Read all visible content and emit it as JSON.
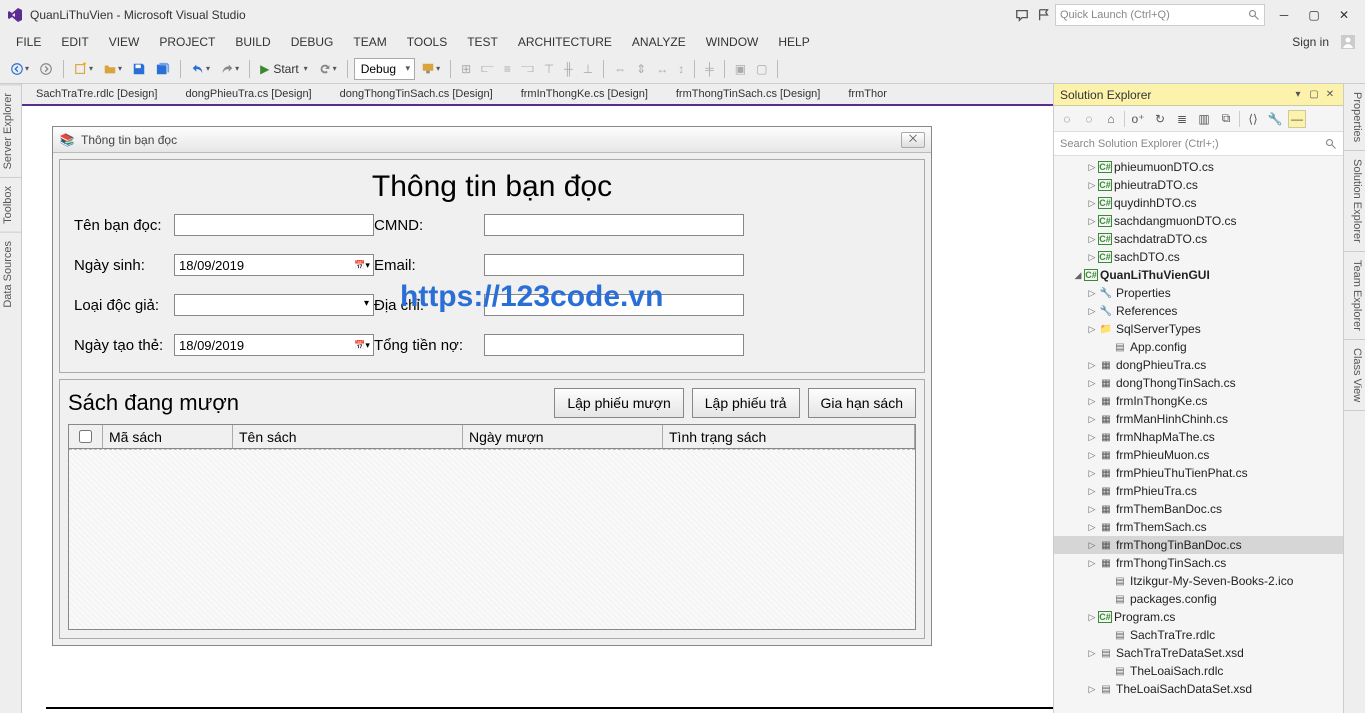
{
  "titlebar": {
    "app_title": "QuanLiThuVien - Microsoft Visual Studio",
    "quick_launch_placeholder": "Quick Launch (Ctrl+Q)"
  },
  "menubar": {
    "items": [
      "FILE",
      "EDIT",
      "VIEW",
      "PROJECT",
      "BUILD",
      "DEBUG",
      "TEAM",
      "TOOLS",
      "TEST",
      "ARCHITECTURE",
      "ANALYZE",
      "WINDOW",
      "HELP"
    ],
    "signin": "Sign in"
  },
  "toolbar": {
    "start_label": "Start",
    "config": "Debug"
  },
  "doc_tabs": [
    "SachTraTre.rdlc [Design]",
    "dongPhieuTra.cs [Design]",
    "dongThongTinSach.cs [Design]",
    "frmInThongKe.cs [Design]",
    "frmThongTinSach.cs [Design]",
    "frmThor"
  ],
  "form": {
    "window_title": "Thông tin bạn đọc",
    "heading": "Thông tin bạn đọc",
    "labels": {
      "ten": "Tên bạn đọc:",
      "cmnd": "CMND:",
      "ngaysinh": "Ngày sinh:",
      "email": "Email:",
      "loai": "Loại độc giả:",
      "diachi": "Địa chỉ:",
      "ngaytao": "Ngày tạo thẻ:",
      "tongtien": "Tổng tiền nợ:"
    },
    "values": {
      "ngaysinh": "18/09/2019",
      "ngaytao": "18/09/2019"
    },
    "overlay": "https://123code.vn",
    "group2_title": "Sách đang mượn",
    "buttons": {
      "lapmuon": "Lập phiếu mượn",
      "laptra": "Lập phiếu trả",
      "giahan": "Gia hạn sách"
    },
    "columns": [
      "Mã sách",
      "Tên sách",
      "Ngày mượn",
      "Tình trạng sách"
    ]
  },
  "solution_explorer": {
    "title": "Solution Explorer",
    "search_placeholder": "Search Solution Explorer (Ctrl+;)",
    "tree": [
      {
        "depth": 2,
        "tw": "▷",
        "ico": "cs",
        "label": "phieumuonDTO.cs"
      },
      {
        "depth": 2,
        "tw": "▷",
        "ico": "cs",
        "label": "phieutraDTO.cs"
      },
      {
        "depth": 2,
        "tw": "▷",
        "ico": "cs",
        "label": "quydinhDTO.cs"
      },
      {
        "depth": 2,
        "tw": "▷",
        "ico": "cs",
        "label": "sachdangmuonDTO.cs"
      },
      {
        "depth": 2,
        "tw": "▷",
        "ico": "cs",
        "label": "sachdatraDTO.cs"
      },
      {
        "depth": 2,
        "tw": "▷",
        "ico": "cs",
        "label": "sachDTO.cs"
      },
      {
        "depth": 1,
        "tw": "◢",
        "ico": "cs",
        "label": "QuanLiThuVienGUI",
        "bold": true
      },
      {
        "depth": 2,
        "tw": "▷",
        "ico": "ref",
        "label": "Properties"
      },
      {
        "depth": 2,
        "tw": "▷",
        "ico": "ref",
        "label": "References"
      },
      {
        "depth": 2,
        "tw": "▷",
        "ico": "fold",
        "label": "SqlServerTypes"
      },
      {
        "depth": 3,
        "tw": "",
        "ico": "cfg",
        "label": "App.config"
      },
      {
        "depth": 2,
        "tw": "▷",
        "ico": "frm",
        "label": "dongPhieuTra.cs"
      },
      {
        "depth": 2,
        "tw": "▷",
        "ico": "frm",
        "label": "dongThongTinSach.cs"
      },
      {
        "depth": 2,
        "tw": "▷",
        "ico": "frm",
        "label": "frmInThongKe.cs"
      },
      {
        "depth": 2,
        "tw": "▷",
        "ico": "frm",
        "label": "frmManHinhChinh.cs"
      },
      {
        "depth": 2,
        "tw": "▷",
        "ico": "frm",
        "label": "frmNhapMaThe.cs"
      },
      {
        "depth": 2,
        "tw": "▷",
        "ico": "frm",
        "label": "frmPhieuMuon.cs"
      },
      {
        "depth": 2,
        "tw": "▷",
        "ico": "frm",
        "label": "frmPhieuThuTienPhat.cs"
      },
      {
        "depth": 2,
        "tw": "▷",
        "ico": "frm",
        "label": "frmPhieuTra.cs"
      },
      {
        "depth": 2,
        "tw": "▷",
        "ico": "frm",
        "label": "frmThemBanDoc.cs"
      },
      {
        "depth": 2,
        "tw": "▷",
        "ico": "frm",
        "label": "frmThemSach.cs"
      },
      {
        "depth": 2,
        "tw": "▷",
        "ico": "frm",
        "label": "frmThongTinBanDoc.cs",
        "sel": true
      },
      {
        "depth": 2,
        "tw": "▷",
        "ico": "frm",
        "label": "frmThongTinSach.cs"
      },
      {
        "depth": 3,
        "tw": "",
        "ico": "cfg",
        "label": "Itzikgur-My-Seven-Books-2.ico"
      },
      {
        "depth": 3,
        "tw": "",
        "ico": "cfg",
        "label": "packages.config"
      },
      {
        "depth": 2,
        "tw": "▷",
        "ico": "cs",
        "label": "Program.cs"
      },
      {
        "depth": 3,
        "tw": "",
        "ico": "cfg",
        "label": "SachTraTre.rdlc"
      },
      {
        "depth": 2,
        "tw": "▷",
        "ico": "cfg",
        "label": "SachTraTreDataSet.xsd"
      },
      {
        "depth": 3,
        "tw": "",
        "ico": "cfg",
        "label": "TheLoaiSach.rdlc"
      },
      {
        "depth": 2,
        "tw": "▷",
        "ico": "cfg",
        "label": "TheLoaiSachDataSet.xsd"
      }
    ]
  },
  "left_wells": [
    "Server Explorer",
    "Toolbox",
    "Data Sources"
  ],
  "right_wells": [
    "Properties",
    "Solution Explorer",
    "Team Explorer",
    "Class View"
  ]
}
